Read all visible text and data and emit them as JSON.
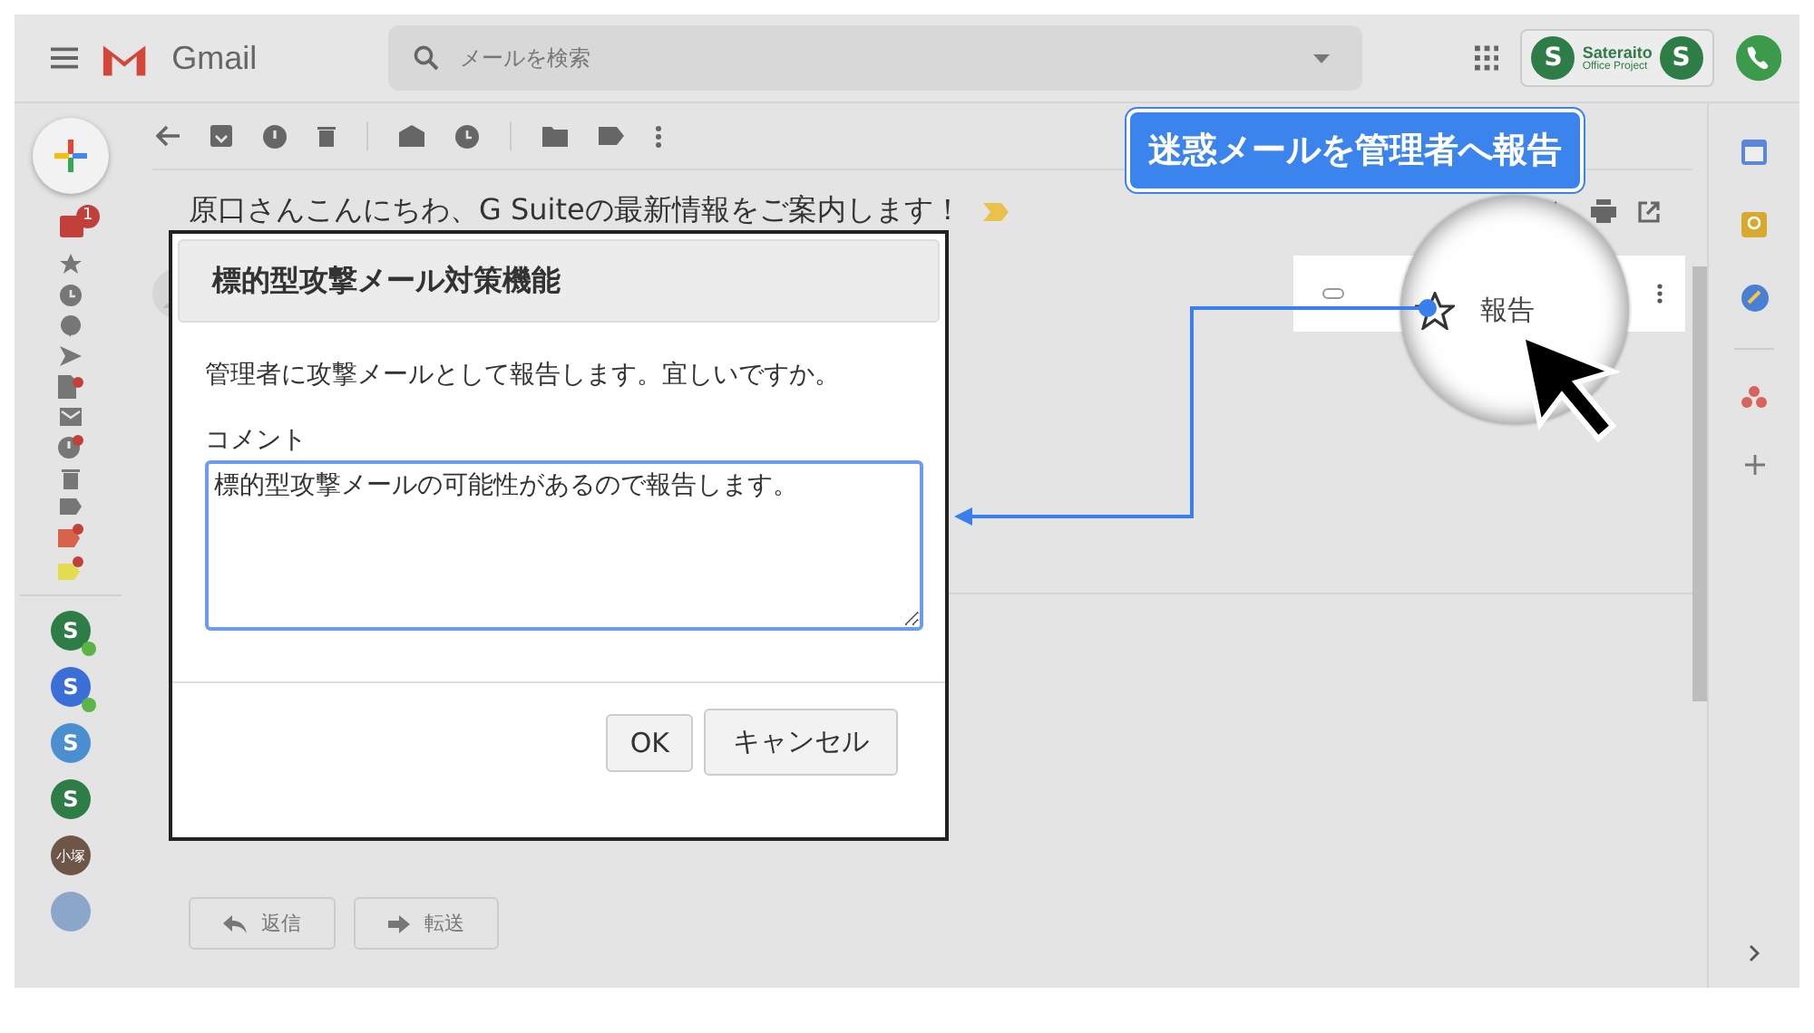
{
  "header": {
    "app_name": "Gmail",
    "search": {
      "placeholder": "メールを検索"
    },
    "account_logo": {
      "left_seal": "S",
      "line1": "Sateraito",
      "line2": "Office Project",
      "right_seal": "S"
    }
  },
  "sidebar": {
    "inbox_badge": "1",
    "contacts": [
      {
        "kind": "logo",
        "letter": "S",
        "color": "#2f7d46",
        "online": true
      },
      {
        "kind": "logo",
        "letter": "S",
        "color": "#3b6fd8",
        "online": true
      },
      {
        "kind": "logo",
        "letter": "S",
        "color": "#4a8fd0",
        "online": false
      },
      {
        "kind": "logo",
        "letter": "S",
        "color": "#2f7d46",
        "online": false
      },
      {
        "kind": "initials",
        "text": "小塚",
        "color": "#6d5548",
        "online": false
      },
      {
        "kind": "photo",
        "color": "#8aa7c9",
        "online": false
      }
    ]
  },
  "message": {
    "subject": "原口さんこんにちわ、G Suiteの最新情報をご案内します！",
    "actions": [
      {
        "kind": "reply",
        "label": "返信"
      },
      {
        "kind": "forward",
        "label": "転送"
      }
    ]
  },
  "callout": {
    "text": "迷惑メールを管理者へ報告"
  },
  "magnifier": {
    "label": "報告"
  },
  "dialog": {
    "title": "標的型攻撃メール対策機能",
    "message": "管理者に攻撃メールとして報告します。宜しいですか。",
    "comment_label": "コメント",
    "comment_value": "標的型攻撃メールの可能性があるので報告します。",
    "buttons": [
      {
        "label": "OK"
      },
      {
        "label": "キャンセル"
      }
    ]
  }
}
